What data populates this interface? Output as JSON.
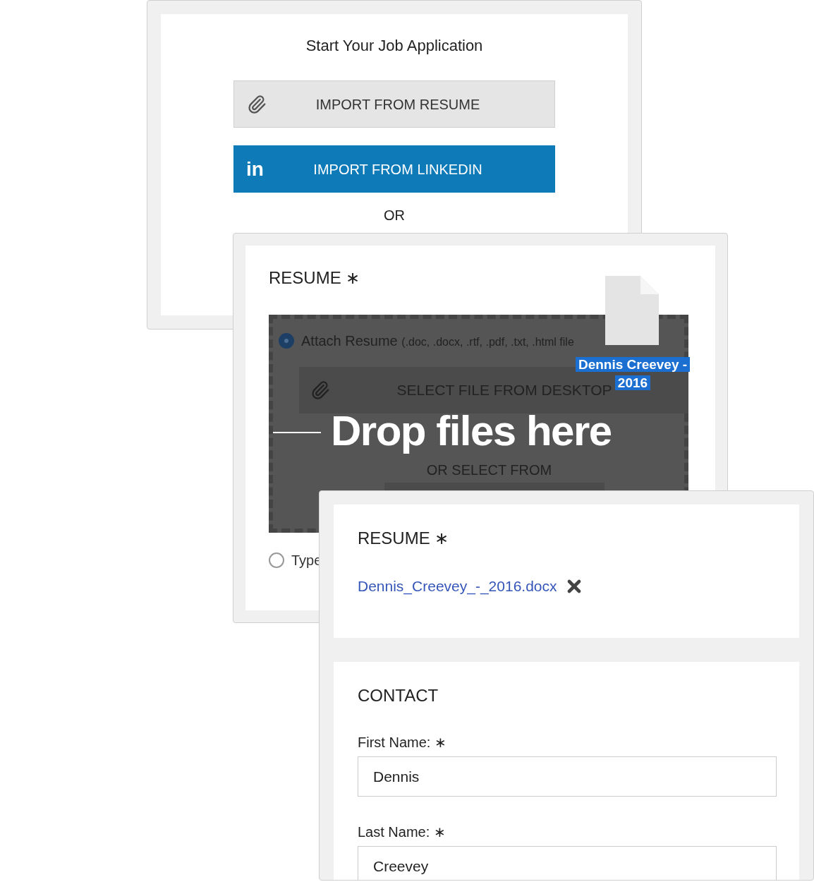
{
  "start_card": {
    "title": "Start Your Job Application",
    "buttons": [
      {
        "kind": "resume",
        "label": "IMPORT FROM RESUME"
      },
      {
        "kind": "linkedin",
        "icon_text": "in",
        "label": "IMPORT FROM LINKEDIN"
      }
    ],
    "separator": "OR"
  },
  "upload_card": {
    "heading": "RESUME",
    "required_mark": "∗",
    "drop_zone": {
      "active": true,
      "message": "Drop files here",
      "dragged_file": "Dennis Creevey - 2016"
    },
    "options": [
      {
        "label": "Attach Resume",
        "hint": "(.doc, .docx, .rtf, .pdf, .txt, .html file",
        "selected": true
      },
      {
        "label": "Type",
        "selected": false
      }
    ],
    "select_button": "SELECT FILE FROM DESKTOP",
    "or_select": "OR SELECT FROM"
  },
  "form_card": {
    "required_mark": "∗",
    "resume": {
      "heading": "RESUME",
      "file_name": "Dennis_Creevey_-_2016.docx"
    },
    "contact": {
      "heading": "CONTACT",
      "fields": [
        {
          "label": "First Name:",
          "required": true,
          "value": "Dennis"
        },
        {
          "label": "Last Name:",
          "required": true,
          "value": "Creevey"
        }
      ]
    }
  }
}
